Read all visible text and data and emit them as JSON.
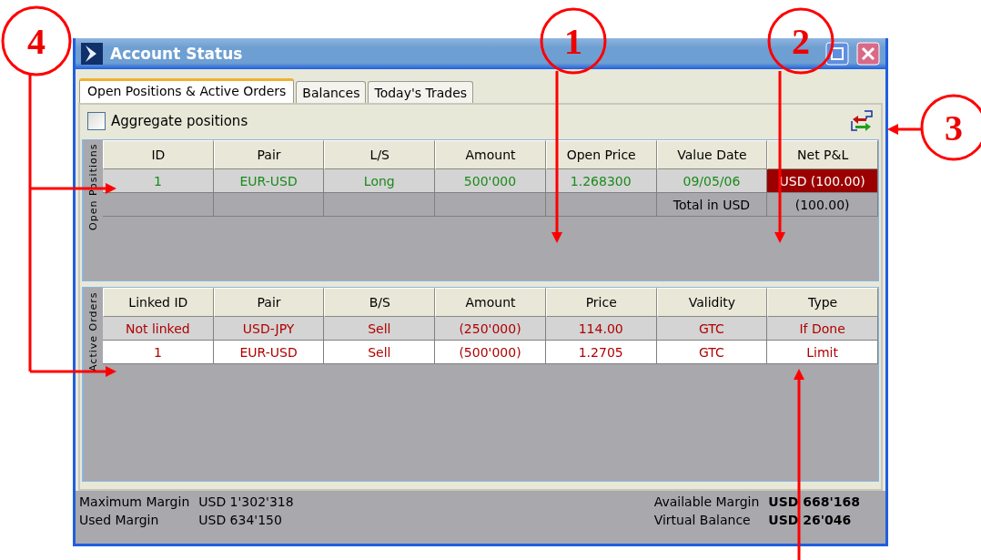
{
  "window": {
    "title": "Account Status"
  },
  "tabs": [
    {
      "label": "Open Positions & Active Orders",
      "selected": true
    },
    {
      "label": "Balances",
      "selected": false
    },
    {
      "label": "Today's Trades",
      "selected": false
    }
  ],
  "aggregate": {
    "label": "Aggregate positions",
    "checked": false
  },
  "open_positions": {
    "side_label": "Open Positions",
    "columns": [
      "ID",
      "Pair",
      "L/S",
      "Amount",
      "Open Price",
      "Value Date",
      "Net P&L"
    ],
    "rows": [
      {
        "kind": "position",
        "cells": [
          "1",
          "EUR-USD",
          "Long",
          "500'000",
          "1.268300",
          "09/05/06",
          "USD (100.00)"
        ],
        "loss": true
      },
      {
        "kind": "total",
        "label": "Total in USD",
        "value": "(100.00)"
      }
    ]
  },
  "active_orders": {
    "side_label": "Active Orders",
    "columns": [
      "Linked ID",
      "Pair",
      "B/S",
      "Amount",
      "Price",
      "Validity",
      "Type"
    ],
    "rows": [
      {
        "cells": [
          "Not linked",
          "USD-JPY",
          "Sell",
          "(250'000)",
          "114.00",
          "GTC",
          "If Done"
        ],
        "selected": false
      },
      {
        "cells": [
          "1",
          "EUR-USD",
          "Sell",
          "(500'000)",
          "1.2705",
          "GTC",
          "Limit"
        ],
        "selected": true
      }
    ]
  },
  "status_bar": {
    "left": [
      {
        "label": "Maximum Margin",
        "value": "USD 1'302'318"
      },
      {
        "label": "Used Margin",
        "value": "USD 634'150"
      }
    ],
    "right": [
      {
        "label": "Available Margin",
        "value": "USD 668'168"
      },
      {
        "label": "Virtual Balance",
        "value": "USD 26'046"
      }
    ]
  },
  "callouts": [
    {
      "label": "4"
    },
    {
      "label": "1"
    },
    {
      "label": "2"
    },
    {
      "label": "3"
    }
  ]
}
